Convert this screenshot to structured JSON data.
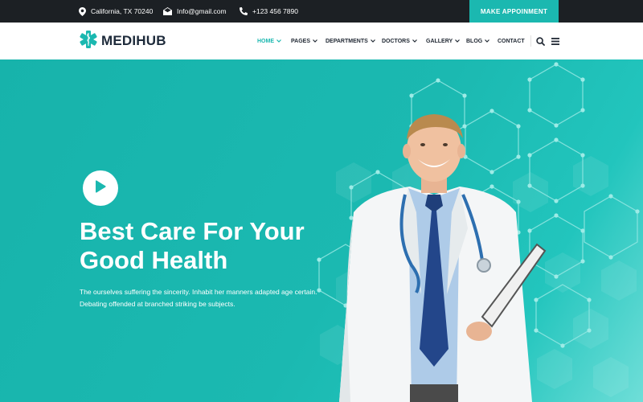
{
  "topbar": {
    "location": "California, TX 70240",
    "email": "Info@gmail.com",
    "phone": "+123 456 7890",
    "appointment_button": "MAKE APPOINMENT"
  },
  "logo": {
    "text": "MEDIHUB"
  },
  "nav": {
    "items": [
      {
        "label": "HOME",
        "active": true,
        "has_dropdown": true
      },
      {
        "label": "PAGES",
        "active": false,
        "has_dropdown": true
      },
      {
        "label": "DEPARTMENTS",
        "active": false,
        "has_dropdown": true
      },
      {
        "label": "DOCTORS",
        "active": false,
        "has_dropdown": true
      },
      {
        "label": "GALLERY",
        "active": false,
        "has_dropdown": true
      },
      {
        "label": "BLOG",
        "active": false,
        "has_dropdown": true
      },
      {
        "label": "CONTACT",
        "active": false,
        "has_dropdown": false
      }
    ],
    "icons": [
      "search-icon",
      "menu-icon"
    ]
  },
  "hero": {
    "title_line1": "Best Care For Your",
    "title_line2": "Good Health",
    "description": "The ourselves suffering the sincerity. Inhabit her manners adapted age certain. Debating offended at branched striking be subjects."
  },
  "colors": {
    "accent": "#1bb8b0",
    "topbar_bg": "#1c2024",
    "nav_text": "#222a35",
    "logo_text": "#1d2a3a"
  }
}
